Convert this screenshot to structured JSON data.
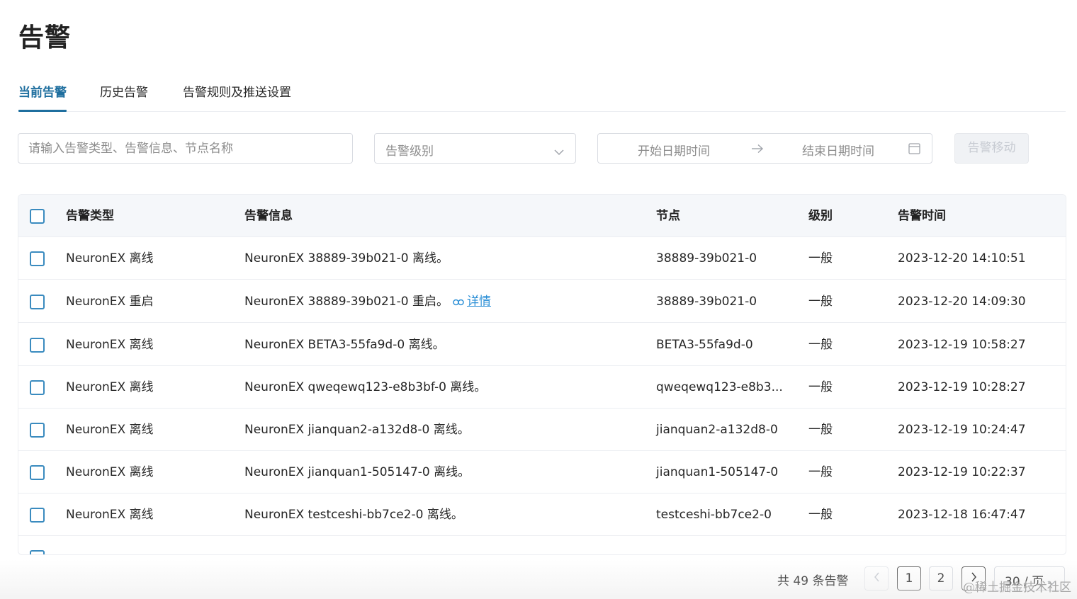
{
  "page": {
    "title": "告警"
  },
  "tabs": [
    {
      "label": "当前告警",
      "active": true
    },
    {
      "label": "历史告警",
      "active": false
    },
    {
      "label": "告警规则及推送设置",
      "active": false
    }
  ],
  "filters": {
    "search_placeholder": "请输入告警类型、告警信息、节点名称",
    "level_placeholder": "告警级别",
    "start_placeholder": "开始日期时间",
    "end_placeholder": "结束日期时间",
    "move_button": "告警移动"
  },
  "table": {
    "columns": {
      "type": "告警类型",
      "message": "告警信息",
      "node": "节点",
      "level": "级别",
      "time": "告警时间"
    },
    "detail_link": "详情",
    "rows": [
      {
        "type": "NeuronEX 离线",
        "message": "NeuronEX 38889-39b021-0 离线。",
        "node": "38889-39b021-0",
        "level": "一般",
        "time": "2023-12-20 14:10:51"
      },
      {
        "type": "NeuronEX 重启",
        "message": "NeuronEX 38889-39b021-0 重启。",
        "node": "38889-39b021-0",
        "level": "一般",
        "time": "2023-12-20 14:09:30"
      },
      {
        "type": "NeuronEX 离线",
        "message": "NeuronEX BETA3-55fa9d-0 离线。",
        "node": "BETA3-55fa9d-0",
        "level": "一般",
        "time": "2023-12-19 10:58:27"
      },
      {
        "type": "NeuronEX 离线",
        "message": "NeuronEX qweqewq123-e8b3bf-0 离线。",
        "node": "qweqewq123-e8b3...",
        "level": "一般",
        "time": "2023-12-19 10:28:27"
      },
      {
        "type": "NeuronEX 离线",
        "message": "NeuronEX jianquan2-a132d8-0 离线。",
        "node": "jianquan2-a132d8-0",
        "level": "一般",
        "time": "2023-12-19 10:24:47"
      },
      {
        "type": "NeuronEX 离线",
        "message": "NeuronEX jianquan1-505147-0 离线。",
        "node": "jianquan1-505147-0",
        "level": "一般",
        "time": "2023-12-19 10:22:37"
      },
      {
        "type": "NeuronEX 离线",
        "message": "NeuronEX testceshi-bb7ce2-0 离线。",
        "node": "testceshi-bb7ce2-0",
        "level": "一般",
        "time": "2023-12-18 16:47:47"
      }
    ]
  },
  "pagination": {
    "total_text": "共 49 条告警",
    "pages": [
      "1",
      "2"
    ],
    "page_size": "30 / 页"
  },
  "watermark": "@稀土掘金技术社区",
  "colors": {
    "accent": "#1f6f9f",
    "link": "#2b8fd6",
    "checkbox": "#3a8bbf"
  },
  "icons": [
    "chevron-down-icon",
    "arrow-right-icon",
    "calendar-icon",
    "link-icon",
    "chevron-left-icon",
    "chevron-right-icon"
  ]
}
